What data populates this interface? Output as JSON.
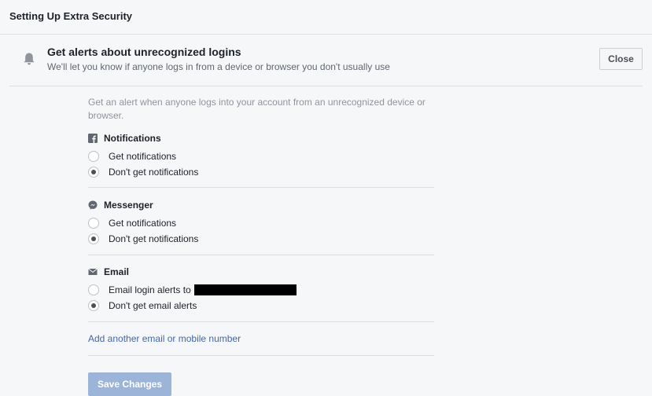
{
  "page": {
    "title": "Setting Up Extra Security"
  },
  "section": {
    "icon": "bell-icon",
    "title": "Get alerts about unrecognized logins",
    "subtitle": "We'll let you know if anyone logs in from a device or browser you don't usually use",
    "close_label": "Close"
  },
  "content": {
    "intro": "Get an alert when anyone logs into your account from an unrecognized device or browser.",
    "groups": [
      {
        "label": "Notifications",
        "icon": "facebook-icon",
        "options": [
          {
            "label": "Get notifications",
            "selected": false
          },
          {
            "label": "Don't get notifications",
            "selected": true
          }
        ]
      },
      {
        "label": "Messenger",
        "icon": "messenger-icon",
        "options": [
          {
            "label": "Get notifications",
            "selected": false
          },
          {
            "label": "Don't get notifications",
            "selected": true
          }
        ]
      },
      {
        "label": "Email",
        "icon": "envelope-icon",
        "options": [
          {
            "label": "Email login alerts to",
            "selected": false
          },
          {
            "label": "Don't get email alerts",
            "selected": true
          }
        ]
      }
    ],
    "add_link": "Add another email or mobile number",
    "save_label": "Save Changes"
  },
  "colors": {
    "background": "#f6f7f9",
    "link": "#4267b2",
    "save_button": "#9cb4d8"
  }
}
